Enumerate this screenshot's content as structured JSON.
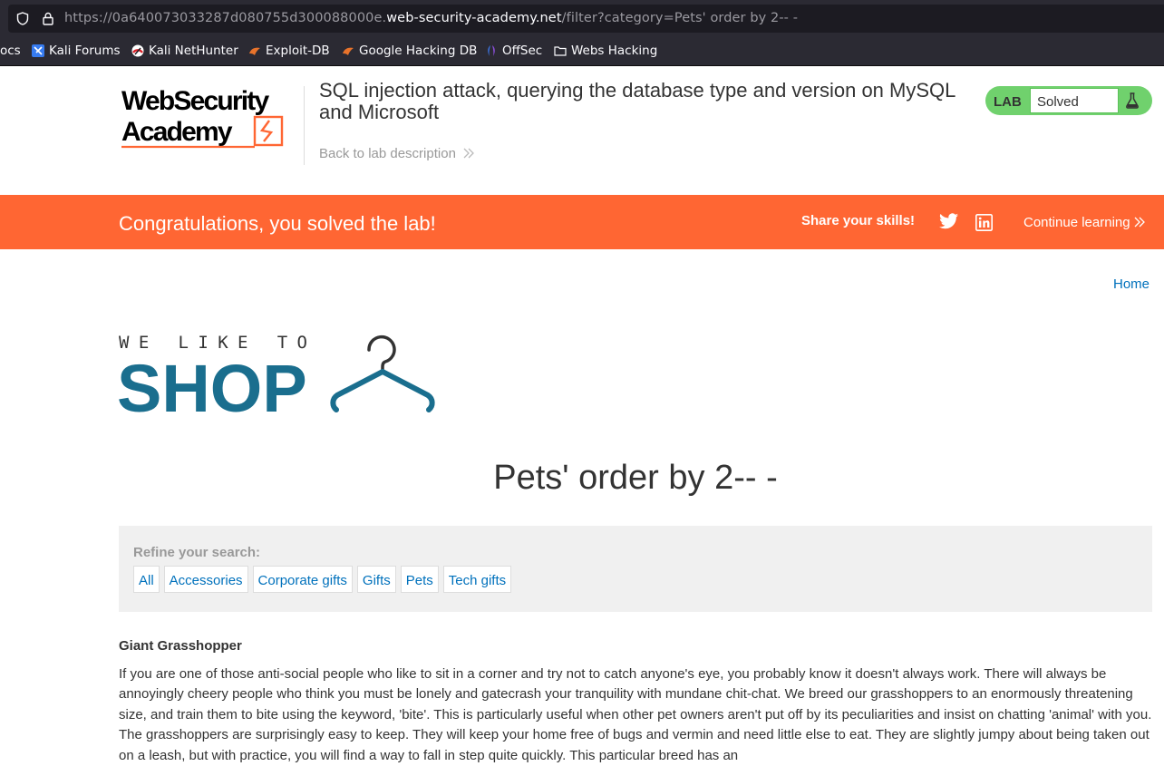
{
  "browser": {
    "url_prefix": "https://0a640073033287d080755d300088000e.",
    "url_domain": "web-security-academy.net",
    "url_path": "/filter?category=Pets' order by 2-- -",
    "bookmarks": [
      {
        "label": "ocs",
        "icon": "none"
      },
      {
        "label": "Kali Forums",
        "icon": "kali-forums-icon"
      },
      {
        "label": "Kali NetHunter",
        "icon": "nethunter-icon"
      },
      {
        "label": "Exploit-DB",
        "icon": "exploit-db-icon"
      },
      {
        "label": "Google Hacking DB",
        "icon": "ghdb-icon"
      },
      {
        "label": "OffSec",
        "icon": "offsec-icon"
      },
      {
        "label": "Webs Hacking",
        "icon": "folder-icon"
      }
    ]
  },
  "lab_header": {
    "logo_line1": "WebSecurity",
    "logo_line2": "Academy",
    "title": "SQL injection attack, querying the database type and version on MySQL and Microsoft",
    "back_link": "Back to lab description",
    "status_label": "LAB",
    "status_value": "Solved"
  },
  "banner": {
    "message": "Congratulations, you solved the lab!",
    "share_label": "Share your skills!",
    "continue_label": "Continue learning"
  },
  "shop": {
    "home_link": "Home",
    "logo_tagline": "WE LIKE TO",
    "logo_word": "SHOP",
    "page_heading": "Pets' order by 2-- -",
    "refine_label": "Refine your search:",
    "categories": [
      "All",
      "Accessories",
      "Corporate gifts",
      "Gifts",
      "Pets",
      "Tech gifts"
    ]
  },
  "product": {
    "name": "Giant Grasshopper",
    "description": "If you are one of those anti-social people who like to sit in a corner and try not to catch anyone's eye, you probably know it doesn't always work. There will always be annoyingly cheery people who think you must be lonely and gatecrash your tranquility with mundane chit-chat. We breed our grasshoppers to an enormously threatening size, and train them to bite using the keyword, 'bite'. This is particularly useful when other pet owners aren't put off by its peculiarities and insist on chatting 'animal' with you. The grasshoppers are surprisingly easy to keep. They will keep your home free of bugs and vermin and need little else to eat. They are slightly jumpy about being taken out on a leash, but with practice, you will find a way to fall in step quite quickly. This particular breed has an"
  },
  "colors": {
    "accent_orange": "#ff6633",
    "solved_green": "#70d16d",
    "link_blue": "#0071bc",
    "shop_blue": "#1a6e8e"
  }
}
